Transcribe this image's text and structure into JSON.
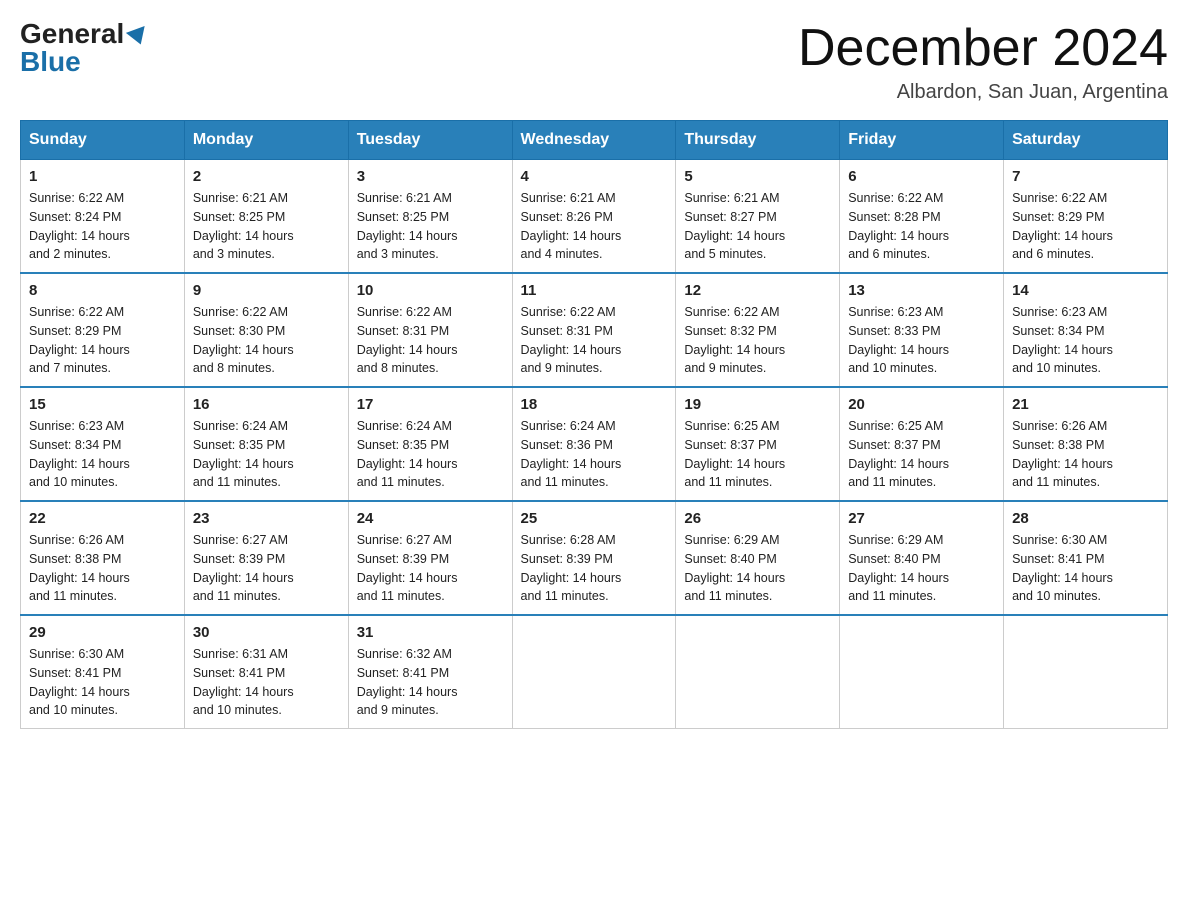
{
  "header": {
    "logo_general": "General",
    "logo_blue": "Blue",
    "month_title": "December 2024",
    "location": "Albardon, San Juan, Argentina"
  },
  "days_of_week": [
    "Sunday",
    "Monday",
    "Tuesday",
    "Wednesday",
    "Thursday",
    "Friday",
    "Saturday"
  ],
  "weeks": [
    [
      {
        "day": "1",
        "sunrise": "6:22 AM",
        "sunset": "8:24 PM",
        "daylight": "14 hours and 2 minutes."
      },
      {
        "day": "2",
        "sunrise": "6:21 AM",
        "sunset": "8:25 PM",
        "daylight": "14 hours and 3 minutes."
      },
      {
        "day": "3",
        "sunrise": "6:21 AM",
        "sunset": "8:25 PM",
        "daylight": "14 hours and 3 minutes."
      },
      {
        "day": "4",
        "sunrise": "6:21 AM",
        "sunset": "8:26 PM",
        "daylight": "14 hours and 4 minutes."
      },
      {
        "day": "5",
        "sunrise": "6:21 AM",
        "sunset": "8:27 PM",
        "daylight": "14 hours and 5 minutes."
      },
      {
        "day": "6",
        "sunrise": "6:22 AM",
        "sunset": "8:28 PM",
        "daylight": "14 hours and 6 minutes."
      },
      {
        "day": "7",
        "sunrise": "6:22 AM",
        "sunset": "8:29 PM",
        "daylight": "14 hours and 6 minutes."
      }
    ],
    [
      {
        "day": "8",
        "sunrise": "6:22 AM",
        "sunset": "8:29 PM",
        "daylight": "14 hours and 7 minutes."
      },
      {
        "day": "9",
        "sunrise": "6:22 AM",
        "sunset": "8:30 PM",
        "daylight": "14 hours and 8 minutes."
      },
      {
        "day": "10",
        "sunrise": "6:22 AM",
        "sunset": "8:31 PM",
        "daylight": "14 hours and 8 minutes."
      },
      {
        "day": "11",
        "sunrise": "6:22 AM",
        "sunset": "8:31 PM",
        "daylight": "14 hours and 9 minutes."
      },
      {
        "day": "12",
        "sunrise": "6:22 AM",
        "sunset": "8:32 PM",
        "daylight": "14 hours and 9 minutes."
      },
      {
        "day": "13",
        "sunrise": "6:23 AM",
        "sunset": "8:33 PM",
        "daylight": "14 hours and 10 minutes."
      },
      {
        "day": "14",
        "sunrise": "6:23 AM",
        "sunset": "8:34 PM",
        "daylight": "14 hours and 10 minutes."
      }
    ],
    [
      {
        "day": "15",
        "sunrise": "6:23 AM",
        "sunset": "8:34 PM",
        "daylight": "14 hours and 10 minutes."
      },
      {
        "day": "16",
        "sunrise": "6:24 AM",
        "sunset": "8:35 PM",
        "daylight": "14 hours and 11 minutes."
      },
      {
        "day": "17",
        "sunrise": "6:24 AM",
        "sunset": "8:35 PM",
        "daylight": "14 hours and 11 minutes."
      },
      {
        "day": "18",
        "sunrise": "6:24 AM",
        "sunset": "8:36 PM",
        "daylight": "14 hours and 11 minutes."
      },
      {
        "day": "19",
        "sunrise": "6:25 AM",
        "sunset": "8:37 PM",
        "daylight": "14 hours and 11 minutes."
      },
      {
        "day": "20",
        "sunrise": "6:25 AM",
        "sunset": "8:37 PM",
        "daylight": "14 hours and 11 minutes."
      },
      {
        "day": "21",
        "sunrise": "6:26 AM",
        "sunset": "8:38 PM",
        "daylight": "14 hours and 11 minutes."
      }
    ],
    [
      {
        "day": "22",
        "sunrise": "6:26 AM",
        "sunset": "8:38 PM",
        "daylight": "14 hours and 11 minutes."
      },
      {
        "day": "23",
        "sunrise": "6:27 AM",
        "sunset": "8:39 PM",
        "daylight": "14 hours and 11 minutes."
      },
      {
        "day": "24",
        "sunrise": "6:27 AM",
        "sunset": "8:39 PM",
        "daylight": "14 hours and 11 minutes."
      },
      {
        "day": "25",
        "sunrise": "6:28 AM",
        "sunset": "8:39 PM",
        "daylight": "14 hours and 11 minutes."
      },
      {
        "day": "26",
        "sunrise": "6:29 AM",
        "sunset": "8:40 PM",
        "daylight": "14 hours and 11 minutes."
      },
      {
        "day": "27",
        "sunrise": "6:29 AM",
        "sunset": "8:40 PM",
        "daylight": "14 hours and 11 minutes."
      },
      {
        "day": "28",
        "sunrise": "6:30 AM",
        "sunset": "8:41 PM",
        "daylight": "14 hours and 10 minutes."
      }
    ],
    [
      {
        "day": "29",
        "sunrise": "6:30 AM",
        "sunset": "8:41 PM",
        "daylight": "14 hours and 10 minutes."
      },
      {
        "day": "30",
        "sunrise": "6:31 AM",
        "sunset": "8:41 PM",
        "daylight": "14 hours and 10 minutes."
      },
      {
        "day": "31",
        "sunrise": "6:32 AM",
        "sunset": "8:41 PM",
        "daylight": "14 hours and 9 minutes."
      },
      null,
      null,
      null,
      null
    ]
  ],
  "labels": {
    "sunrise": "Sunrise:",
    "sunset": "Sunset:",
    "daylight": "Daylight:"
  }
}
